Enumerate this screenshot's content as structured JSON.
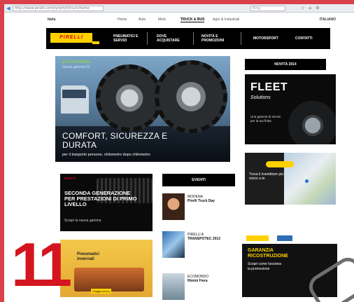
{
  "browser": {
    "url": "http://www.pirelli.com/tyre/it/it/truck/home",
    "search_placeholder": "Bing",
    "icons": [
      "back-icon",
      "star-icon",
      "home-icon",
      "gear-icon"
    ]
  },
  "top_links": {
    "country": "Italia",
    "links": [
      "Home",
      "Auto",
      "Moto",
      "TRUCK & BUS",
      "Agro & Industriali"
    ],
    "active_index": 3,
    "language": "ITALIANO"
  },
  "logo": "PIRELLI",
  "nav": [
    "PNEUMATICI E SERVIZI",
    "DOVE ACQUISTARE",
    "NOVITÀ E PROMOZIONI",
    "MOTORSPORT",
    "CONTATTI"
  ],
  "hero": {
    "kicker": "ECO-ECOPRESS",
    "kicker2": "Nuova gamma 01",
    "title_line1": "COMFORT, SICUREZZA E",
    "title_line2": "DURATA",
    "subtitle": "per il trasporto persone, chilometro dopo chilometro"
  },
  "right": {
    "section_title": "NOVITÀ 2014",
    "fleet_title": "FLEET",
    "fleet_sub": "Solutions",
    "fleet_desc": "Una gamma di servizi per la tua flotta",
    "map_text": "Trova il rivenditore più vicino a te",
    "promo_title_1": "GARANZIA",
    "promo_title_2": "RICOSTRUZIONE",
    "promo_text_1": "Scopri come funziona",
    "promo_text_2": "la promozione"
  },
  "ad": {
    "kicker": "NOVITÀ",
    "title_1": "SECONDA GENERAZIONE",
    "title_2": "PER PRESTAZIONI DI PRIMO",
    "title_3": "LIVELLO",
    "sub": "Scopri la nuova gamma"
  },
  "winter": {
    "text_1": "Pneumatici",
    "text_2": "invernali",
    "note": "Viaggia sicuro"
  },
  "events": {
    "title": "EVENTI",
    "items": [
      {
        "title": "MODENA",
        "subtitle": "Pirelli Truck Day"
      },
      {
        "title": "PIRELLI A",
        "subtitle": "TRANSPOTEC 2013"
      },
      {
        "title": "ECOMONDO",
        "subtitle": "Rimini Fiera"
      }
    ]
  },
  "page_number": "11"
}
